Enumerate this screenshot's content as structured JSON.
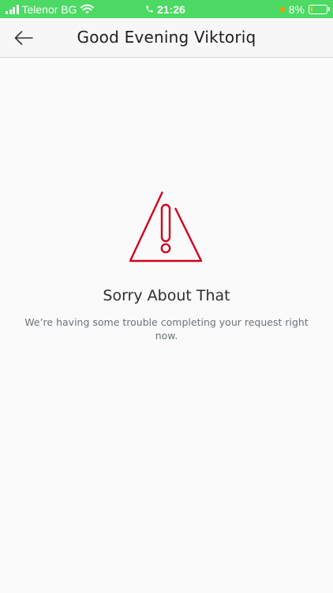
{
  "status_bar": {
    "carrier": "Telenor BG",
    "time": "21:26",
    "battery_percent": "8%",
    "battery_level": 0.08,
    "icons": [
      "signal-icon",
      "wifi-icon",
      "phone-icon",
      "charging-dot",
      "battery-icon"
    ]
  },
  "header": {
    "title": "Good Evening Viktoriq",
    "back_icon": "arrow-left-icon"
  },
  "error": {
    "icon": "warning-icon",
    "title": "Sorry About That",
    "message": "We’re having some trouble completing your request right now."
  },
  "colors": {
    "status_bar_bg": "#4cd964",
    "warning_red": "#d0021b",
    "background": "#fafafa"
  }
}
